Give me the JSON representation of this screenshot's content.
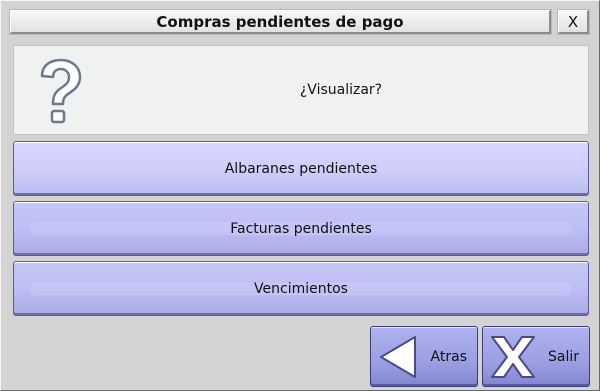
{
  "window": {
    "title": "Compras pendientes de pago",
    "close_label": "X"
  },
  "message": {
    "icon": "question-mark-icon",
    "text": "¿Visualizar?"
  },
  "options": [
    {
      "label": "Albaranes pendientes"
    },
    {
      "label": "Facturas pendientes"
    },
    {
      "label": "Vencimientos"
    }
  ],
  "footer": {
    "back": {
      "label": "Atras",
      "icon": "arrow-left-icon"
    },
    "exit": {
      "label": "Salir",
      "icon": "x-icon"
    }
  },
  "colors": {
    "window_bg": "#d3d3d3",
    "button_accent": "#c5c5f7",
    "nav_button_accent": "#9da1e4"
  }
}
